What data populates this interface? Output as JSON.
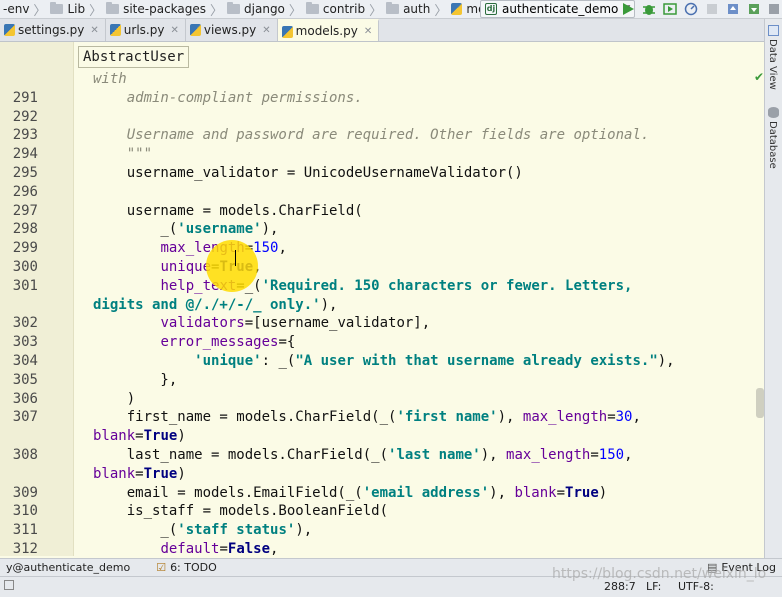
{
  "navbar": {
    "crumbs": [
      "-env",
      "Lib",
      "site-packages",
      "django",
      "contrib",
      "auth",
      "models.py"
    ],
    "run_config": "authenticate_demo"
  },
  "tabs": [
    {
      "label": "settings.py"
    },
    {
      "label": "urls.py"
    },
    {
      "label": "views.py"
    },
    {
      "label": "models.py"
    }
  ],
  "sidebar_right": {
    "data_view": "Data View",
    "database": "Database"
  },
  "editor": {
    "structure_popup": "AbstractUser",
    "lines": [
      {
        "n": "",
        "html": "<span class=\"comment\">with</span>"
      },
      {
        "n": "291",
        "html": "    <span class=\"comment\">admin-compliant permissions.</span>"
      },
      {
        "n": "292",
        "html": ""
      },
      {
        "n": "293",
        "html": "    <span class=\"comment\">Username and password are required. Other fields are optional.</span>"
      },
      {
        "n": "294",
        "html": "    <span class=\"comment\">\"\"\"</span>"
      },
      {
        "n": "295",
        "html": "    username_validator = UnicodeUsernameValidator()"
      },
      {
        "n": "296",
        "html": ""
      },
      {
        "n": "297",
        "html": "    username = models.CharField("
      },
      {
        "n": "298",
        "html": "        _(<span class=\"str\">'username'</span>),"
      },
      {
        "n": "299",
        "html": "        <span class=\"param\">max_length</span>=<span class=\"num\">150</span>,"
      },
      {
        "n": "300",
        "html": "        <span class=\"param\">unique</span>=<span class=\"kw\">True</span>,"
      },
      {
        "n": "301",
        "html": "        <span class=\"param\">help_text</span>=_(<span class=\"str\">'Required. 150 characters or fewer. Letters,</span>"
      },
      {
        "n": "",
        "html": "<span class=\"str\">digits and @/./+/-/_ only.'</span>),"
      },
      {
        "n": "302",
        "html": "        <span class=\"param\">validators</span>=[username_validator],"
      },
      {
        "n": "303",
        "html": "        <span class=\"param\">error_messages</span>={"
      },
      {
        "n": "304",
        "html": "            <span class=\"str\">'unique'</span>: _(<span class=\"str\">\"A user with that username already exists.\"</span>),"
      },
      {
        "n": "305",
        "html": "        },"
      },
      {
        "n": "306",
        "html": "    )"
      },
      {
        "n": "307",
        "html": "    first_name = models.CharField(_(<span class=\"str\">'first name'</span>), <span class=\"param\">max_length</span>=<span class=\"num\">30</span>,"
      },
      {
        "n": "",
        "html": "<span class=\"param\">blank</span>=<span class=\"kw\">True</span>)"
      },
      {
        "n": "308",
        "html": "    last_name = models.CharField(_(<span class=\"str\">'last name'</span>), <span class=\"param\">max_length</span>=<span class=\"num\">150</span>,"
      },
      {
        "n": "",
        "html": "<span class=\"param\">blank</span>=<span class=\"kw\">True</span>)"
      },
      {
        "n": "309",
        "html": "    email = models.EmailField(_(<span class=\"str\">'email address'</span>), <span class=\"param\">blank</span>=<span class=\"kw\">True</span>)"
      },
      {
        "n": "310",
        "html": "    is_staff = models.BooleanField("
      },
      {
        "n": "311",
        "html": "        _(<span class=\"str\">'staff status'</span>),"
      },
      {
        "n": "312",
        "html": "        <span class=\"param\">default</span>=<span class=\"kw\">False</span>,"
      }
    ]
  },
  "status": {
    "run_label": "y@authenticate_demo",
    "todo": "6: TODO",
    "event_log": "Event Log",
    "position": "288:7",
    "line_sep": "LF:",
    "encoding": "UTF-8:"
  },
  "watermark": "https://blog.csdn.net/weixin_lo"
}
